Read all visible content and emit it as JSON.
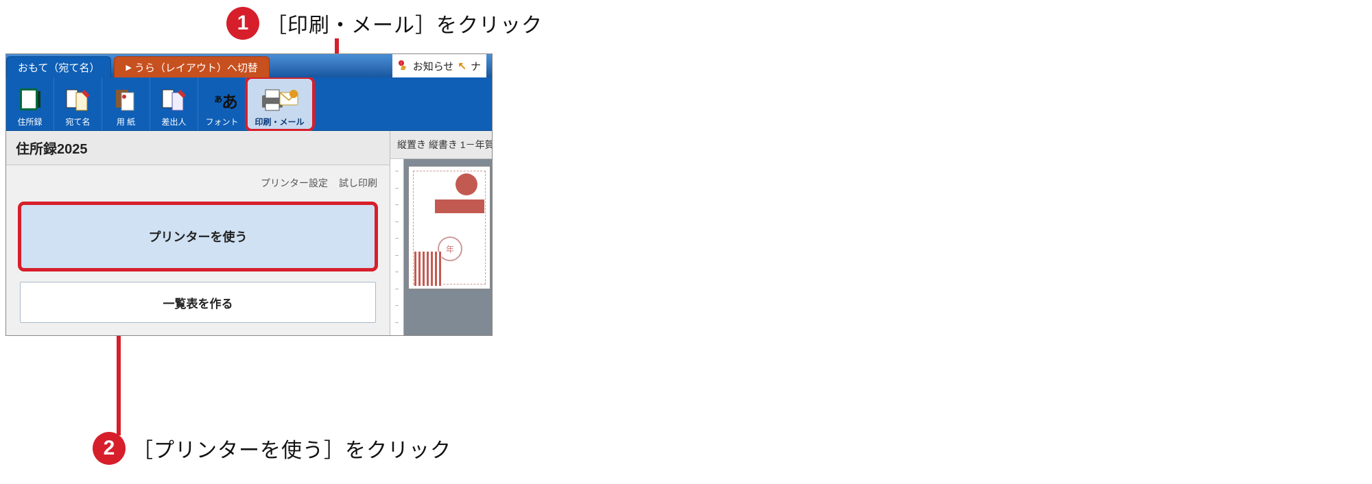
{
  "annotations": {
    "step1_num": "1",
    "step1_text": "［印刷・メール］をクリック",
    "step2_num": "2",
    "step2_text": "［プリンターを使う］をクリック"
  },
  "colors": {
    "accent": "#d61f2b",
    "ribbon": "#0f5fb6",
    "switch_tab": "#c7501f"
  },
  "tabs": {
    "active": "おもて（宛て名）",
    "switch": "うら（レイアウト）へ切替"
  },
  "header_right": {
    "notice_label": "お知らせ",
    "nav_fragment": "ナ"
  },
  "ribbon": [
    {
      "id": "address-book",
      "label": "住所録"
    },
    {
      "id": "addressee",
      "label": "宛て名"
    },
    {
      "id": "paper",
      "label": "用 紙"
    },
    {
      "id": "sender",
      "label": "差出人"
    },
    {
      "id": "font",
      "label": "フォント"
    },
    {
      "id": "print-mail",
      "label": "印刷・メール"
    }
  ],
  "left_panel": {
    "title": "住所録2025",
    "link_printer_settings": "プリンター設定",
    "link_test_print": "試し印刷",
    "btn_use_printer": "プリンターを使う",
    "btn_make_list": "一覧表を作る"
  },
  "preview": {
    "title": "縦置き 縦書き 1－年賀",
    "circle_text": "年"
  }
}
